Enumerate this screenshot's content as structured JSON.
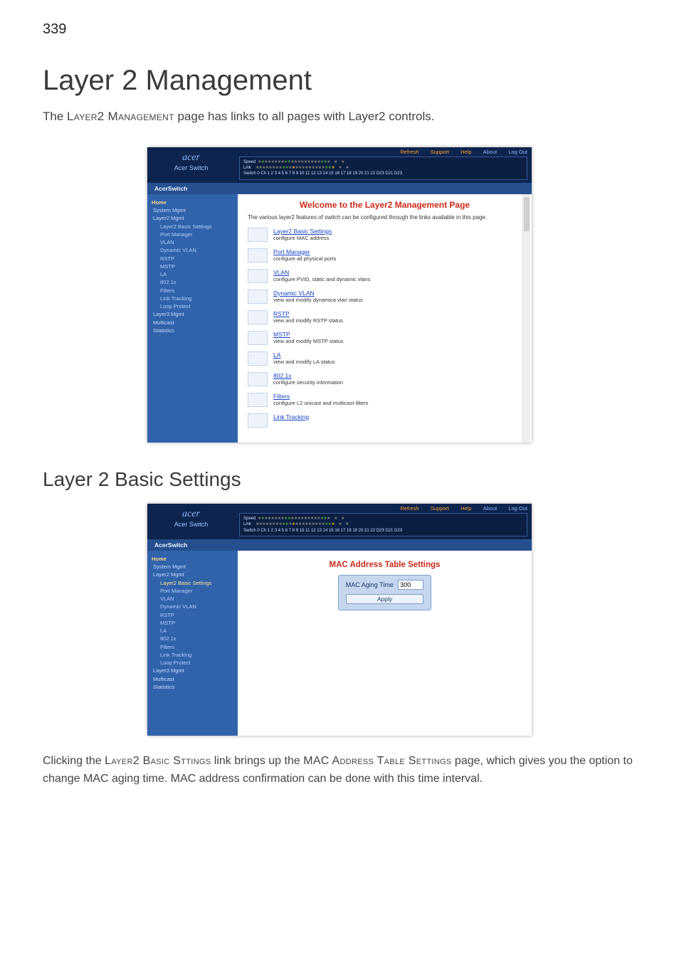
{
  "page_number": "339",
  "h1": "Layer 2 Management",
  "lead_prefix": "The ",
  "lead_sc1": "Layer2 Management",
  "lead_suffix": " page has links to all pages with Layer2 controls.",
  "h2": "Layer 2 Basic Settings",
  "body2_1": "Clicking the ",
  "body2_sc1": "Layer2 Basic Sttings",
  "body2_2": " link brings up the ",
  "body2_sc2": "MAC Address Table Settings",
  "body2_3": " page, which gives you the option to change MAC aging time. MAC address confirmation can be done with this time interval.",
  "switch": {
    "brand": "acer",
    "sub": "Acer Switch",
    "tab": "AcerSwitch",
    "hdr_links": {
      "refresh": "Refresh",
      "support": "Support",
      "help": "Help",
      "about": "About",
      "logout": "Log Out"
    },
    "port_labels": {
      "speed": "Speed",
      "link": "Link",
      "row": "Switch 0 Ch 1  2  3  4  5  6  7  8  9 10 11 12 13 14 15 16 17 18 19 20 21 22 D23 D21 D23"
    },
    "nav": [
      {
        "lvl": "n0",
        "label": "Home"
      },
      {
        "lvl": "n1",
        "label": "System Mgmt"
      },
      {
        "lvl": "n1",
        "label": "Layer2 Mgmt"
      },
      {
        "lvl": "n2",
        "label": "Layer2 Basic Settings"
      },
      {
        "lvl": "n2",
        "label": "Port Manager"
      },
      {
        "lvl": "n2",
        "label": "VLAN"
      },
      {
        "lvl": "n2",
        "label": "Dynamic VLAN"
      },
      {
        "lvl": "n2",
        "label": "RSTP"
      },
      {
        "lvl": "n2",
        "label": "MSTP"
      },
      {
        "lvl": "n2",
        "label": "LA"
      },
      {
        "lvl": "n2",
        "label": "802.1x"
      },
      {
        "lvl": "n2",
        "label": "Filters"
      },
      {
        "lvl": "n2",
        "label": "Link Tracking"
      },
      {
        "lvl": "n2",
        "label": "Loop Protect"
      },
      {
        "lvl": "n1",
        "label": "Layer3 Mgmt"
      },
      {
        "lvl": "n1",
        "label": "Multicast"
      },
      {
        "lvl": "n1",
        "label": "Statistics"
      }
    ]
  },
  "shot1": {
    "welcome": "Welcome to the Layer2 Management Page",
    "intro": "The various layer2 features of switch can be configured through the links available in this page.",
    "items": [
      {
        "title": "Layer2 Basic Settings",
        "desc": "configure MAC address"
      },
      {
        "title": "Port Manager",
        "desc": "configure all physical ports"
      },
      {
        "title": "VLAN",
        "desc": "configure PVID, static and dynamic vlans"
      },
      {
        "title": "Dynamic VLAN",
        "desc": "view and modify dynamica vlan status"
      },
      {
        "title": "RSTP",
        "desc": "view and modify RSTP status"
      },
      {
        "title": "MSTP",
        "desc": "view and modify MSTP status"
      },
      {
        "title": "LA",
        "desc": "view and modify LA status"
      },
      {
        "title": "802.1x",
        "desc": "configure security information"
      },
      {
        "title": "Filters",
        "desc": "configure L2 unicast and multicast filters"
      },
      {
        "title": "Link Tracking",
        "desc": ""
      }
    ]
  },
  "shot2": {
    "title": "MAC Address Table Settings",
    "field_label": "MAC Aging Time",
    "field_value": "300",
    "button": "Apply"
  }
}
